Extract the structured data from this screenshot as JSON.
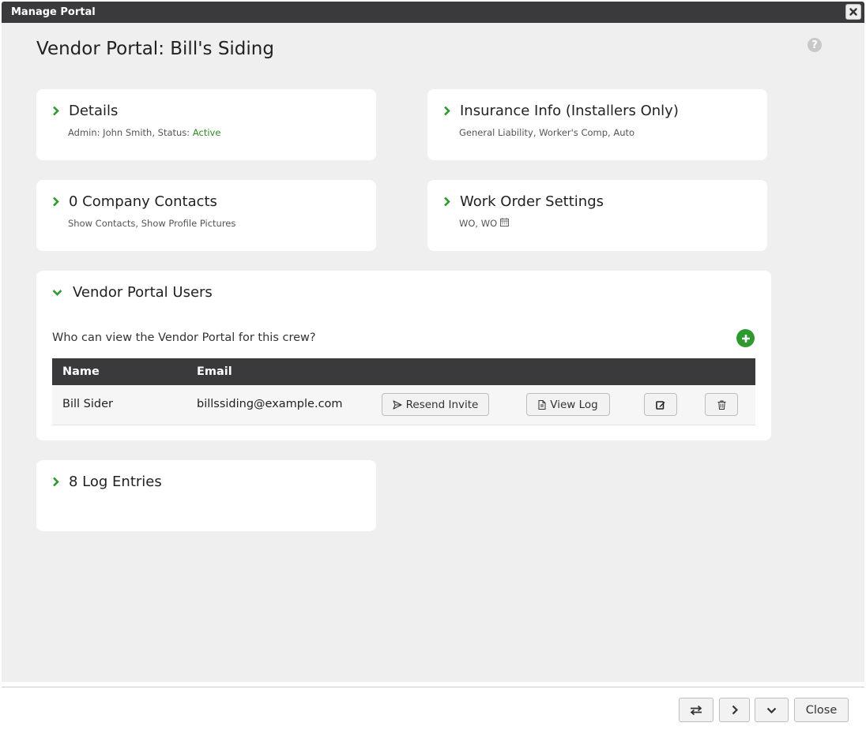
{
  "window": {
    "title": "Manage Portal"
  },
  "page": {
    "title": "Vendor Portal: Bill's Siding"
  },
  "cards": {
    "details": {
      "title": "Details",
      "admin_text": "Admin: John Smith, Status: ",
      "status": "Active"
    },
    "insurance": {
      "title": "Insurance Info (Installers Only)",
      "sub": "General Liability, Worker's Comp, Auto"
    },
    "contacts": {
      "title": "0 Company Contacts",
      "sub": "Show Contacts, Show Profile Pictures"
    },
    "work_orders": {
      "title": "Work Order Settings",
      "sub": "WO, WO"
    },
    "log": {
      "title": "8 Log Entries"
    }
  },
  "users": {
    "title": "Vendor Portal Users",
    "question": "Who can view the Vendor Portal for this crew?",
    "columns": [
      "Name",
      "Email"
    ],
    "rows": [
      {
        "name": "Bill Sider",
        "email": "billssiding@example.com"
      }
    ],
    "resend_label": "Resend Invite",
    "view_log_label": "View Log"
  },
  "footer": {
    "close_label": "Close"
  },
  "colors": {
    "accent": "#2e9a2e",
    "titlebar": "#3a3a3c",
    "status_active": "#2e8b1f"
  }
}
